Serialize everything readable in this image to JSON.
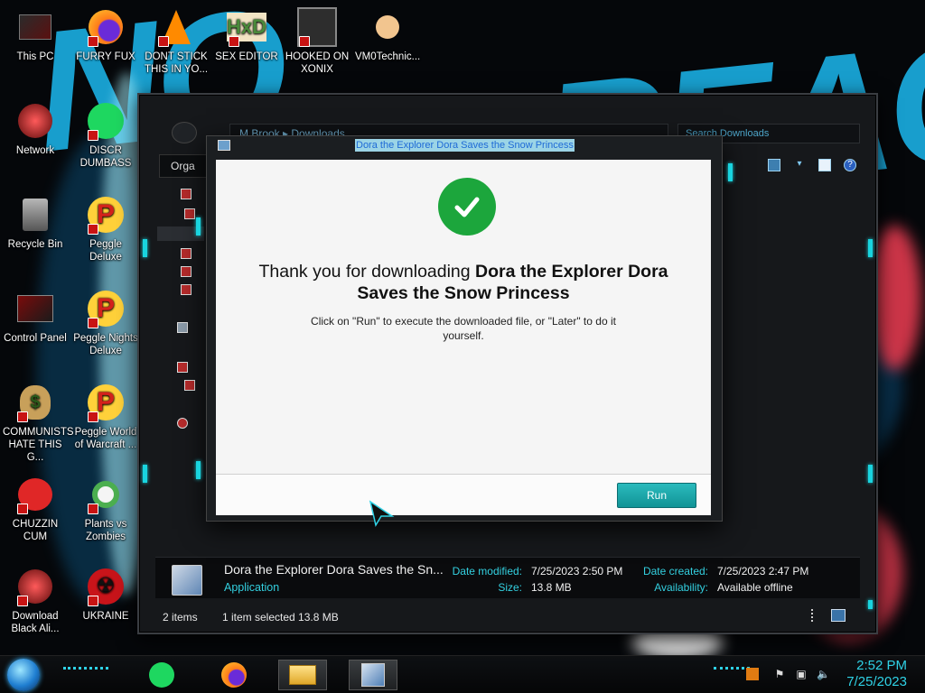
{
  "desktop": {
    "icons": [
      {
        "label": "This PC"
      },
      {
        "label": "FURRY FUX"
      },
      {
        "label": "DONT STICK THIS IN YO..."
      },
      {
        "label": "SEX EDITOR"
      },
      {
        "label": "HOOKED ON XONIX"
      },
      {
        "label": "VM0Technic..."
      },
      {
        "label": "Network"
      },
      {
        "label": "DISCR DUMBASS"
      },
      {
        "label": "Recycle Bin"
      },
      {
        "label": "Peggle Deluxe"
      },
      {
        "label": "Control Panel"
      },
      {
        "label": "Peggle Nights Deluxe"
      },
      {
        "label": "COMMUNISTS HATE THIS G..."
      },
      {
        "label": "Peggle World of Warcraft ..."
      },
      {
        "label": "CHUZZIN CUM"
      },
      {
        "label": "Plants vs Zombies"
      },
      {
        "label": "Download Black Ali..."
      },
      {
        "label": "UKRAINE"
      }
    ]
  },
  "explorer": {
    "address": "M Brook ▸ Downloads",
    "search_placeholder": "Search Downloads",
    "organize_label": "Orga",
    "details": {
      "file_name": "Dora the Explorer Dora Saves the Sn...",
      "file_type": "Application",
      "date_modified_label": "Date modified:",
      "date_modified_value": "7/25/2023 2:50 PM",
      "size_label": "Size:",
      "size_value": "13.8 MB",
      "date_created_label": "Date created:",
      "date_created_value": "7/25/2023 2:47 PM",
      "availability_label": "Availability:",
      "availability_value": "Available offline"
    },
    "status": {
      "items": "2 items",
      "selected": "1 item selected  13.8 MB"
    }
  },
  "dialog": {
    "title": "Dora the Explorer Dora Saves the Snow Princess",
    "heading_prefix": "Thank you for downloading ",
    "heading_bold": "Dora the Explorer Dora Saves the Snow Princess",
    "description": "Click on \"Run\" to execute the downloaded file, or \"Later\" to do it yourself.",
    "run_label": "Run",
    "accent": "#1ca63c"
  },
  "taskbar": {
    "time": "2:52 PM",
    "date": "7/25/2023",
    "apps": [
      "spotify-icon",
      "firefox-icon",
      "file-explorer-icon",
      "installer-icon"
    ]
  }
}
